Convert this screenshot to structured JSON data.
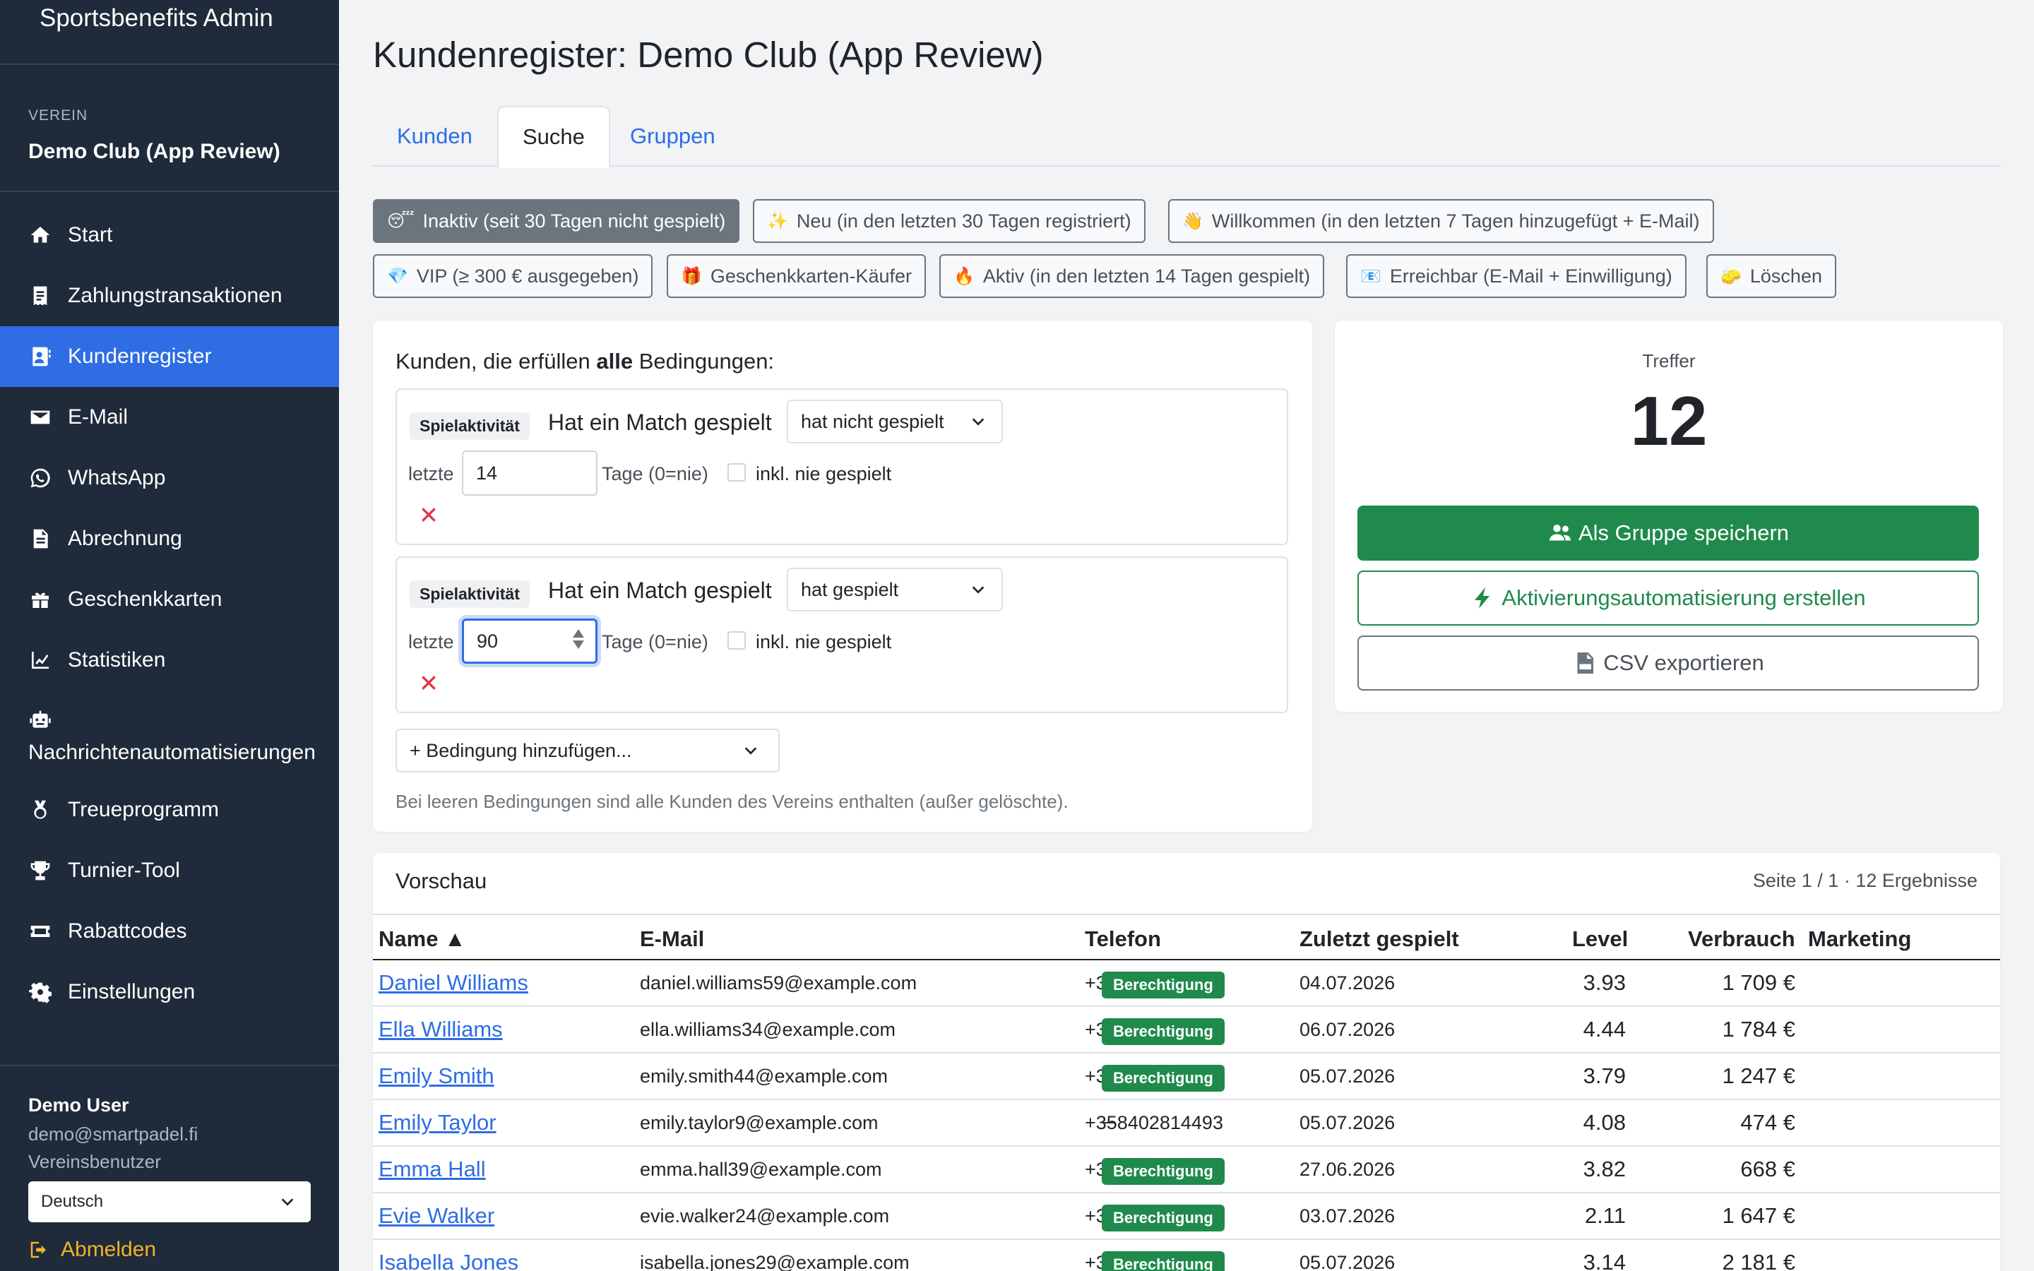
{
  "brand": "Sportsbenefits Admin",
  "club": {
    "caption": "VEREIN",
    "name": "Demo Club (App Review)"
  },
  "nav": [
    {
      "label": "Start",
      "icon": "home-icon"
    },
    {
      "label": "Zahlungstransaktionen",
      "icon": "receipt-icon"
    },
    {
      "label": "Kundenregister",
      "icon": "address-book-icon"
    },
    {
      "label": "E-Mail",
      "icon": "envelope-icon"
    },
    {
      "label": "WhatsApp",
      "icon": "whatsapp-icon"
    },
    {
      "label": "Abrechnung",
      "icon": "invoice-icon"
    },
    {
      "label": "Geschenkkarten",
      "icon": "gift-icon"
    },
    {
      "label": "Statistiken",
      "icon": "chart-line-icon"
    },
    {
      "label": "Nachrichtenautomatisierungen",
      "icon": "robot-icon"
    },
    {
      "label": "Treueprogramm",
      "icon": "medal-icon"
    },
    {
      "label": "Turnier-Tool",
      "icon": "trophy-icon"
    },
    {
      "label": "Rabattcodes",
      "icon": "ticket-icon"
    },
    {
      "label": "Einstellungen",
      "icon": "gear-icon"
    }
  ],
  "user": {
    "name": "Demo User",
    "email": "demo@smartpadel.fi",
    "role": "Vereinsbenutzer",
    "language": "Deutsch",
    "logout": "Abmelden"
  },
  "page_title": "Kundenregister: Demo Club (App Review)",
  "tabs": [
    "Kunden",
    "Suche",
    "Gruppen"
  ],
  "chips": [
    {
      "emoji": "😴",
      "label": "Inaktiv (seit 30 Tagen nicht gespielt)"
    },
    {
      "emoji": "✨",
      "label": "Neu (in den letzten 30 Tagen registriert)"
    },
    {
      "emoji": "👋",
      "label": "Willkommen (in den letzten 7 Tagen hinzugefügt + E-Mail)"
    },
    {
      "emoji": "💎",
      "label": "VIP (≥ 300 € ausgegeben)"
    },
    {
      "emoji": "🎁",
      "label": "Geschenkkarten-Käufer"
    },
    {
      "emoji": "🔥",
      "label": "Aktiv (in den letzten 14 Tagen gespielt)"
    },
    {
      "emoji": "📧",
      "label": "Erreichbar (E-Mail + Einwilligung)"
    },
    {
      "emoji": "🧽",
      "label": "Löschen"
    }
  ],
  "conditions": {
    "title_pre": "Kunden, die erfüllen ",
    "title_bold": "alle",
    "title_post": " Bedingungen:",
    "items": [
      {
        "badge": "Spielaktivität",
        "label": "Hat ein Match gespielt",
        "operator": "hat nicht gespielt",
        "prefix": "letzte",
        "days": "14",
        "suffix": "Tage (0=nie)",
        "checkbox_label": "inkl. nie gespielt"
      },
      {
        "badge": "Spielaktivität",
        "label": "Hat ein Match gespielt",
        "operator": "hat gespielt",
        "prefix": "letzte",
        "days": "90",
        "suffix": "Tage (0=nie)",
        "checkbox_label": "inkl. nie gespielt"
      }
    ],
    "add_label": "+ Bedingung hinzufügen...",
    "hint": "Bei leeren Bedingungen sind alle Kunden des Vereins enthalten (außer gelöschte)."
  },
  "hits": {
    "caption": "Treffer",
    "value": "12",
    "save_group": "Als Gruppe speichern",
    "create_automation": "Aktivierungsautomatisierung erstellen",
    "export_csv": "CSV exportieren"
  },
  "preview": {
    "title": "Vorschau",
    "meta": "Seite 1 / 1 · 12 Ergebnisse",
    "columns": [
      "Name ▲",
      "E-Mail",
      "Telefon",
      "Zuletzt gespielt",
      "Level",
      "Verbrauch",
      "Marketing"
    ],
    "rows": [
      {
        "name": "Daniel Williams",
        "email": "daniel.williams59@example.com",
        "phone": "+358409690879",
        "last": "04.07.2026",
        "level": "3.93",
        "spend": "1 709 €",
        "marketing": "Berechtigung"
      },
      {
        "name": "Ella Williams",
        "email": "ella.williams34@example.com",
        "phone": "+358408233127",
        "last": "06.07.2026",
        "level": "4.44",
        "spend": "1 784 €",
        "marketing": "Berechtigung"
      },
      {
        "name": "Emily Smith",
        "email": "emily.smith44@example.com",
        "phone": "+358408195728",
        "last": "05.07.2026",
        "level": "3.79",
        "spend": "1 247 €",
        "marketing": "Berechtigung"
      },
      {
        "name": "Emily Taylor",
        "email": "emily.taylor9@example.com",
        "phone": "+358402814493",
        "last": "05.07.2026",
        "level": "4.08",
        "spend": "474 €",
        "marketing": "–"
      },
      {
        "name": "Emma Hall",
        "email": "emma.hall39@example.com",
        "phone": "+358401993551",
        "last": "27.06.2026",
        "level": "3.82",
        "spend": "668 €",
        "marketing": "Berechtigung"
      },
      {
        "name": "Evie Walker",
        "email": "evie.walker24@example.com",
        "phone": "+358403456710",
        "last": "03.07.2026",
        "level": "2.11",
        "spend": "1 647 €",
        "marketing": "Berechtigung"
      },
      {
        "name": "Isabella Jones",
        "email": "isabella.jones29@example.com",
        "phone": "+358407609451",
        "last": "05.07.2026",
        "level": "3.14",
        "spend": "2 181 €",
        "marketing": "Berechtigung"
      }
    ]
  }
}
